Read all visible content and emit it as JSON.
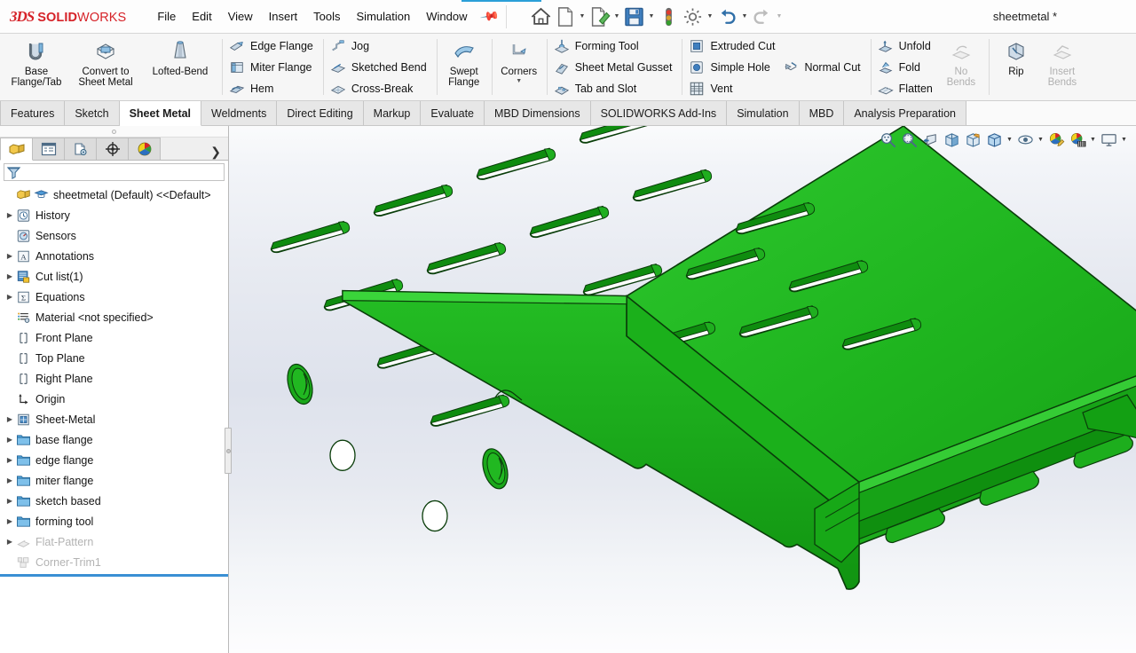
{
  "app": {
    "brand_ds": "3DS",
    "brand_bold": "SOLID",
    "brand_light": "WORKS",
    "document_title": "sheetmetal *",
    "accent_color": "#d62329",
    "model_color": "#22b822",
    "highlight_color": "#3a8fd4"
  },
  "menu": {
    "items": [
      {
        "label": "File"
      },
      {
        "label": "Edit"
      },
      {
        "label": "View"
      },
      {
        "label": "Insert"
      },
      {
        "label": "Tools"
      },
      {
        "label": "Simulation"
      },
      {
        "label": "Window"
      }
    ],
    "pin_icon": "pin-icon"
  },
  "quick_access": {
    "buttons": [
      {
        "name": "home-icon",
        "label": "Home",
        "has_caret": false,
        "disabled": false
      },
      {
        "name": "new-document-icon",
        "label": "New",
        "has_caret": true,
        "disabled": false
      },
      {
        "name": "open-document-icon",
        "label": "Open",
        "has_caret": true,
        "disabled": false
      },
      {
        "name": "save-icon",
        "label": "Save",
        "has_caret": true,
        "disabled": false
      },
      {
        "name": "rebuild-icon",
        "label": "Rebuild",
        "has_caret": false,
        "disabled": false
      },
      {
        "name": "options-gear-icon",
        "label": "Options",
        "has_caret": true,
        "disabled": false
      },
      {
        "name": "undo-icon",
        "label": "Undo",
        "has_caret": true,
        "disabled": false
      },
      {
        "name": "redo-icon",
        "label": "Redo",
        "has_caret": true,
        "disabled": true
      }
    ]
  },
  "ribbon": {
    "groups": [
      {
        "name": "base-group",
        "big_buttons": [
          {
            "label_line1": "Base",
            "label_line2": "Flange/Tab",
            "icon": "base-flange-icon",
            "disabled": false
          },
          {
            "label_line1": "Convert to",
            "label_line2": "Sheet Metal",
            "icon": "convert-to-sheet-metal-icon",
            "disabled": false
          },
          {
            "label_line1": "Lofted-Bend",
            "label_line2": "",
            "icon": "lofted-bend-icon",
            "disabled": false
          }
        ]
      },
      {
        "name": "flange-group",
        "small_buttons": [
          {
            "label": "Edge Flange",
            "icon": "edge-flange-icon",
            "disabled": false
          },
          {
            "label": "Miter Flange",
            "icon": "miter-flange-icon",
            "disabled": false
          },
          {
            "label": "Hem",
            "icon": "hem-icon",
            "disabled": false
          }
        ]
      },
      {
        "name": "bend-group",
        "small_buttons": [
          {
            "label": "Jog",
            "icon": "jog-icon",
            "disabled": false
          },
          {
            "label": "Sketched Bend",
            "icon": "sketched-bend-icon",
            "disabled": false
          },
          {
            "label": "Cross-Break",
            "icon": "cross-break-icon",
            "disabled": false
          }
        ]
      },
      {
        "name": "swept-flange-group",
        "big_buttons": [
          {
            "label_line1": "Swept",
            "label_line2": "Flange",
            "icon": "swept-flange-icon",
            "disabled": false
          }
        ]
      },
      {
        "name": "corners-group",
        "big_buttons": [
          {
            "label_line1": "Corners",
            "label_line2": "",
            "icon": "corners-icon",
            "disabled": false,
            "caret": true
          }
        ]
      },
      {
        "name": "forming-group",
        "small_buttons": [
          {
            "label": "Forming Tool",
            "icon": "forming-tool-icon",
            "disabled": false
          },
          {
            "label": "Sheet Metal Gusset",
            "icon": "sheet-metal-gusset-icon",
            "disabled": false
          },
          {
            "label": "Tab and Slot",
            "icon": "tab-and-slot-icon",
            "disabled": false
          }
        ]
      },
      {
        "name": "cut-group",
        "small_buttons": [
          {
            "label": "Extruded Cut",
            "icon": "extruded-cut-icon",
            "disabled": false
          },
          {
            "label": "Simple Hole",
            "icon": "simple-hole-icon",
            "disabled": false
          },
          {
            "label": "Vent",
            "icon": "vent-icon",
            "disabled": false
          }
        ],
        "small_buttons2": [
          {
            "label": "Normal Cut",
            "icon": "normal-cut-icon",
            "disabled": false
          }
        ]
      },
      {
        "name": "fold-group",
        "small_buttons": [
          {
            "label": "Unfold",
            "icon": "unfold-icon",
            "disabled": false
          },
          {
            "label": "Fold",
            "icon": "fold-icon",
            "disabled": false
          },
          {
            "label": "Flatten",
            "icon": "flatten-icon",
            "disabled": false
          }
        ],
        "big_buttons": [
          {
            "label_line1": "No",
            "label_line2": "Bends",
            "icon": "no-bends-icon",
            "disabled": true
          }
        ]
      },
      {
        "name": "rip-group",
        "big_buttons": [
          {
            "label_line1": "Rip",
            "label_line2": "",
            "icon": "rip-icon",
            "disabled": false
          },
          {
            "label_line1": "Insert",
            "label_line2": "Bends",
            "icon": "insert-bends-icon",
            "disabled": true
          }
        ]
      }
    ]
  },
  "command_tabs": {
    "active": "Sheet Metal",
    "tabs": [
      {
        "label": "Features"
      },
      {
        "label": "Sketch"
      },
      {
        "label": "Sheet Metal"
      },
      {
        "label": "Weldments"
      },
      {
        "label": "Direct Editing"
      },
      {
        "label": "Markup"
      },
      {
        "label": "Evaluate"
      },
      {
        "label": "MBD Dimensions"
      },
      {
        "label": "SOLIDWORKS Add-Ins"
      },
      {
        "label": "Simulation"
      },
      {
        "label": "MBD"
      },
      {
        "label": "Analysis Preparation"
      }
    ]
  },
  "feature_manager": {
    "tabs": [
      {
        "name": "feature-tree-tab",
        "icon": "feature-tree-icon",
        "active": true
      },
      {
        "name": "property-manager-tab",
        "icon": "property-manager-icon",
        "active": false
      },
      {
        "name": "configuration-manager-tab",
        "icon": "configuration-manager-icon",
        "active": false
      },
      {
        "name": "dimxpert-manager-tab",
        "icon": "dimxpert-icon",
        "active": false
      },
      {
        "name": "display-manager-tab",
        "icon": "appearances-sphere-icon",
        "active": false
      }
    ],
    "more_icon": "chevron-right-icon",
    "filter": {
      "placeholder": "",
      "value": "",
      "icon": "filter-funnel-icon"
    },
    "tree": [
      {
        "label": "sheetmetal (Default) <<Default>",
        "icon": "part-icon",
        "indent": 0,
        "twist": false,
        "dim": false,
        "root": true
      },
      {
        "label": "History",
        "icon": "history-icon",
        "indent": 1,
        "twist": true,
        "dim": false
      },
      {
        "label": "Sensors",
        "icon": "sensors-icon",
        "indent": 1,
        "twist": false,
        "dim": false
      },
      {
        "label": "Annotations",
        "icon": "annotations-icon",
        "indent": 1,
        "twist": true,
        "dim": false
      },
      {
        "label": "Cut list(1)",
        "icon": "cut-list-icon",
        "indent": 1,
        "twist": true,
        "dim": false
      },
      {
        "label": "Equations",
        "icon": "equations-icon",
        "indent": 1,
        "twist": true,
        "dim": false
      },
      {
        "label": "Material <not specified>",
        "icon": "material-icon",
        "indent": 1,
        "twist": false,
        "dim": false
      },
      {
        "label": "Front Plane",
        "icon": "plane-icon",
        "indent": 1,
        "twist": false,
        "dim": false
      },
      {
        "label": "Top Plane",
        "icon": "plane-icon",
        "indent": 1,
        "twist": false,
        "dim": false
      },
      {
        "label": "Right Plane",
        "icon": "plane-icon",
        "indent": 1,
        "twist": false,
        "dim": false
      },
      {
        "label": "Origin",
        "icon": "origin-icon",
        "indent": 1,
        "twist": false,
        "dim": false
      },
      {
        "label": "Sheet-Metal",
        "icon": "sheet-metal-icon",
        "indent": 1,
        "twist": true,
        "dim": false
      },
      {
        "label": "base flange",
        "icon": "folder-icon",
        "indent": 1,
        "twist": true,
        "dim": false
      },
      {
        "label": "edge flange",
        "icon": "folder-icon",
        "indent": 1,
        "twist": true,
        "dim": false
      },
      {
        "label": "miter flange",
        "icon": "folder-icon",
        "indent": 1,
        "twist": true,
        "dim": false
      },
      {
        "label": "sketch based",
        "icon": "folder-icon",
        "indent": 1,
        "twist": true,
        "dim": false
      },
      {
        "label": "forming tool",
        "icon": "folder-icon",
        "indent": 1,
        "twist": true,
        "dim": false
      },
      {
        "label": "Flat-Pattern",
        "icon": "flat-pattern-icon",
        "indent": 1,
        "twist": true,
        "dim": true
      },
      {
        "label": "Corner-Trim1",
        "icon": "corner-trim-icon",
        "indent": 1,
        "twist": false,
        "dim": true
      }
    ]
  },
  "view_toolbar": {
    "buttons": [
      {
        "name": "zoom-to-fit-icon",
        "label": "Zoom to Fit",
        "caret": false
      },
      {
        "name": "zoom-to-area-icon",
        "label": "Zoom to Area",
        "caret": false
      },
      {
        "name": "previous-view-icon",
        "label": "Previous View",
        "caret": false
      },
      {
        "name": "section-view-icon",
        "label": "Section View",
        "caret": false
      },
      {
        "name": "view-orientation-icon",
        "label": "View Orientation",
        "caret": false
      },
      {
        "name": "display-style-icon",
        "label": "Display Style",
        "caret": true
      },
      {
        "name": "hide-show-items-icon",
        "label": "Hide/Show Items",
        "caret": true
      },
      {
        "name": "edit-appearance-icon",
        "label": "Edit Appearance",
        "caret": true
      },
      {
        "name": "apply-scene-icon",
        "label": "Apply Scene",
        "caret": true
      },
      {
        "name": "view-settings-icon",
        "label": "View Settings",
        "caret": true
      }
    ]
  },
  "model": {
    "name": "sheet-metal-part-model",
    "description": "Isometric green sheet metal enclosure with louver vents, hems, forming tool features and holes",
    "face_color": "#22b822",
    "face_color_dark": "#169016",
    "face_color_mid": "#1eab1e",
    "edge_color": "#0d3f0d"
  }
}
